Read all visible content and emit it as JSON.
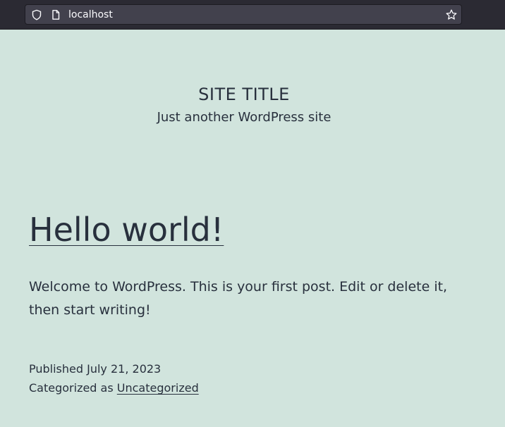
{
  "browser": {
    "url": "localhost"
  },
  "site": {
    "title": "SITE TITLE",
    "tagline": "Just another WordPress site"
  },
  "post": {
    "title": "Hello world!",
    "body": "Welcome to WordPress. This is your first post. Edit or delete it, then start writing!",
    "published_label": "Published",
    "published_date": "July 21, 2023",
    "category_label": "Categorized as",
    "category": "Uncategorized"
  },
  "colors": {
    "page_background": "#d1e4dd",
    "text": "#28303d",
    "browser_chrome": "#2b2a33"
  }
}
